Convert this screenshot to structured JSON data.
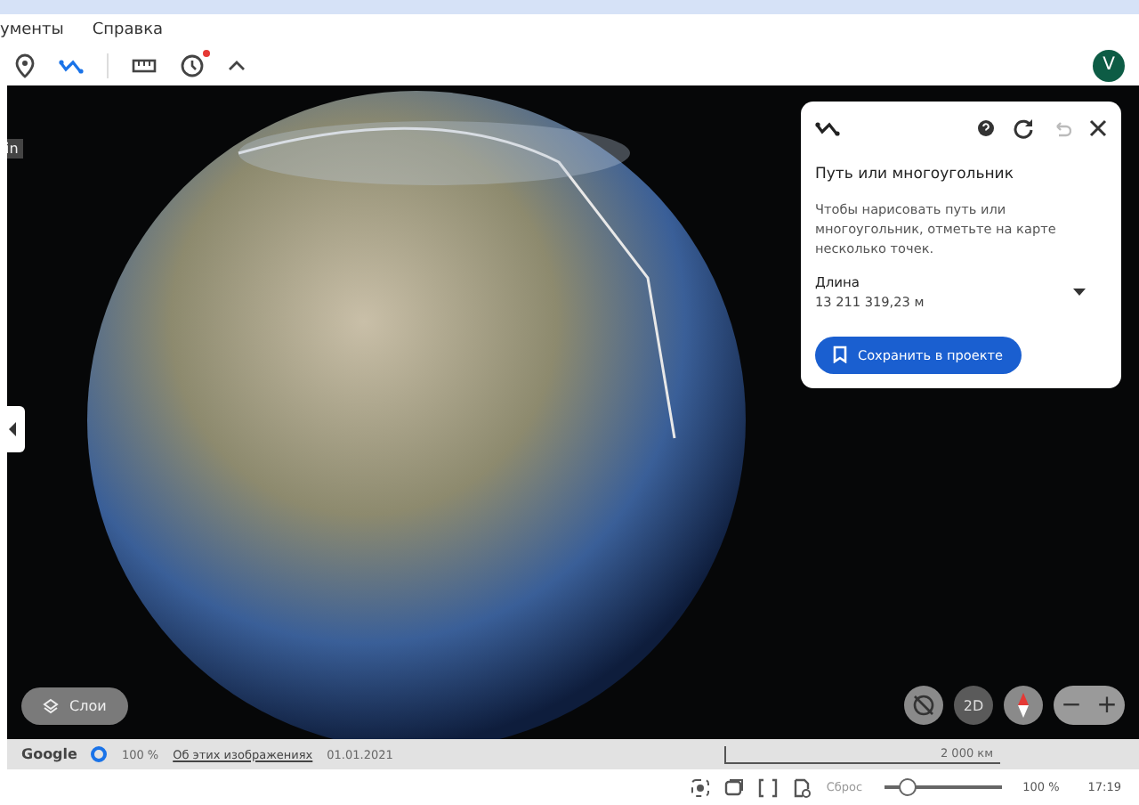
{
  "menu": [
    "ументы",
    "Справка"
  ],
  "toolbar": {
    "new_badge": true
  },
  "account": {
    "initial": "V"
  },
  "side_tooltip": "in",
  "panel": {
    "title": "Путь или многоугольник",
    "hint": "Чтобы нарисовать путь или многоугольник, отметьте на карте несколько точек.",
    "measure_label": "Длина",
    "measure_value": "13 211 319,23 м",
    "save_button": "Сохранить в проекте",
    "undo_disabled": true
  },
  "map_controls": {
    "layers_button": "Слои",
    "mode_button": "2D",
    "zoom_out": "−",
    "zoom_in": "+"
  },
  "status_bar": {
    "brand": "Google",
    "loading": "100 %",
    "link": "Об этих изображениях",
    "date": "01.01.2021",
    "scale": "2 000 км"
  },
  "bottom_bar": {
    "reset": "Сброс",
    "level": 0.2,
    "zoom": "100 %",
    "time": "17:19"
  }
}
